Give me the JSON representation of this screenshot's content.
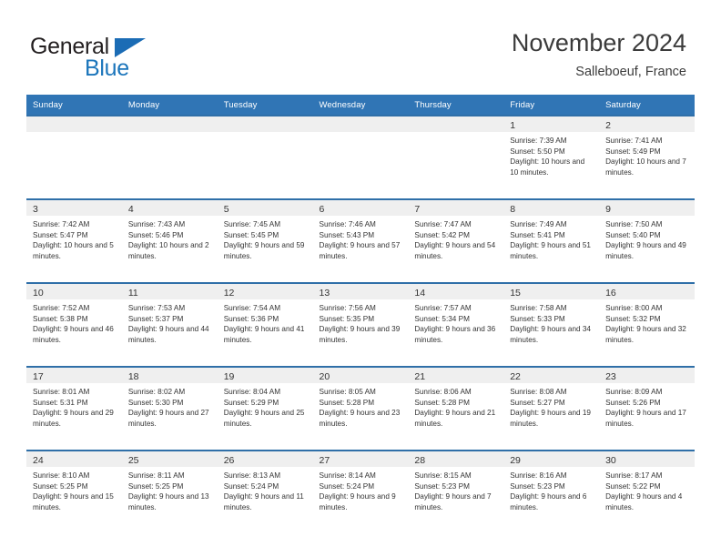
{
  "brand": {
    "word1": "General",
    "word2": "Blue",
    "triangle_color": "#1b6cb5",
    "word2_color": "#1b75bb"
  },
  "header": {
    "title": "November 2024",
    "subtitle": "Salleboeuf, France"
  },
  "colors": {
    "header_blue": "#3075b5",
    "row_border_blue": "#2f6fa8",
    "daynum_band": "#efefef",
    "text": "#333333"
  },
  "calendar": {
    "weekday_headers": [
      "Sunday",
      "Monday",
      "Tuesday",
      "Wednesday",
      "Thursday",
      "Friday",
      "Saturday"
    ],
    "weeks": [
      [
        {
          "day": "",
          "sunrise": "",
          "sunset": "",
          "daylight": ""
        },
        {
          "day": "",
          "sunrise": "",
          "sunset": "",
          "daylight": ""
        },
        {
          "day": "",
          "sunrise": "",
          "sunset": "",
          "daylight": ""
        },
        {
          "day": "",
          "sunrise": "",
          "sunset": "",
          "daylight": ""
        },
        {
          "day": "",
          "sunrise": "",
          "sunset": "",
          "daylight": ""
        },
        {
          "day": "1",
          "sunrise": "Sunrise: 7:39 AM",
          "sunset": "Sunset: 5:50 PM",
          "daylight": "Daylight: 10 hours and 10 minutes."
        },
        {
          "day": "2",
          "sunrise": "Sunrise: 7:41 AM",
          "sunset": "Sunset: 5:49 PM",
          "daylight": "Daylight: 10 hours and 7 minutes."
        }
      ],
      [
        {
          "day": "3",
          "sunrise": "Sunrise: 7:42 AM",
          "sunset": "Sunset: 5:47 PM",
          "daylight": "Daylight: 10 hours and 5 minutes."
        },
        {
          "day": "4",
          "sunrise": "Sunrise: 7:43 AM",
          "sunset": "Sunset: 5:46 PM",
          "daylight": "Daylight: 10 hours and 2 minutes."
        },
        {
          "day": "5",
          "sunrise": "Sunrise: 7:45 AM",
          "sunset": "Sunset: 5:45 PM",
          "daylight": "Daylight: 9 hours and 59 minutes."
        },
        {
          "day": "6",
          "sunrise": "Sunrise: 7:46 AM",
          "sunset": "Sunset: 5:43 PM",
          "daylight": "Daylight: 9 hours and 57 minutes."
        },
        {
          "day": "7",
          "sunrise": "Sunrise: 7:47 AM",
          "sunset": "Sunset: 5:42 PM",
          "daylight": "Daylight: 9 hours and 54 minutes."
        },
        {
          "day": "8",
          "sunrise": "Sunrise: 7:49 AM",
          "sunset": "Sunset: 5:41 PM",
          "daylight": "Daylight: 9 hours and 51 minutes."
        },
        {
          "day": "9",
          "sunrise": "Sunrise: 7:50 AM",
          "sunset": "Sunset: 5:40 PM",
          "daylight": "Daylight: 9 hours and 49 minutes."
        }
      ],
      [
        {
          "day": "10",
          "sunrise": "Sunrise: 7:52 AM",
          "sunset": "Sunset: 5:38 PM",
          "daylight": "Daylight: 9 hours and 46 minutes."
        },
        {
          "day": "11",
          "sunrise": "Sunrise: 7:53 AM",
          "sunset": "Sunset: 5:37 PM",
          "daylight": "Daylight: 9 hours and 44 minutes."
        },
        {
          "day": "12",
          "sunrise": "Sunrise: 7:54 AM",
          "sunset": "Sunset: 5:36 PM",
          "daylight": "Daylight: 9 hours and 41 minutes."
        },
        {
          "day": "13",
          "sunrise": "Sunrise: 7:56 AM",
          "sunset": "Sunset: 5:35 PM",
          "daylight": "Daylight: 9 hours and 39 minutes."
        },
        {
          "day": "14",
          "sunrise": "Sunrise: 7:57 AM",
          "sunset": "Sunset: 5:34 PM",
          "daylight": "Daylight: 9 hours and 36 minutes."
        },
        {
          "day": "15",
          "sunrise": "Sunrise: 7:58 AM",
          "sunset": "Sunset: 5:33 PM",
          "daylight": "Daylight: 9 hours and 34 minutes."
        },
        {
          "day": "16",
          "sunrise": "Sunrise: 8:00 AM",
          "sunset": "Sunset: 5:32 PM",
          "daylight": "Daylight: 9 hours and 32 minutes."
        }
      ],
      [
        {
          "day": "17",
          "sunrise": "Sunrise: 8:01 AM",
          "sunset": "Sunset: 5:31 PM",
          "daylight": "Daylight: 9 hours and 29 minutes."
        },
        {
          "day": "18",
          "sunrise": "Sunrise: 8:02 AM",
          "sunset": "Sunset: 5:30 PM",
          "daylight": "Daylight: 9 hours and 27 minutes."
        },
        {
          "day": "19",
          "sunrise": "Sunrise: 8:04 AM",
          "sunset": "Sunset: 5:29 PM",
          "daylight": "Daylight: 9 hours and 25 minutes."
        },
        {
          "day": "20",
          "sunrise": "Sunrise: 8:05 AM",
          "sunset": "Sunset: 5:28 PM",
          "daylight": "Daylight: 9 hours and 23 minutes."
        },
        {
          "day": "21",
          "sunrise": "Sunrise: 8:06 AM",
          "sunset": "Sunset: 5:28 PM",
          "daylight": "Daylight: 9 hours and 21 minutes."
        },
        {
          "day": "22",
          "sunrise": "Sunrise: 8:08 AM",
          "sunset": "Sunset: 5:27 PM",
          "daylight": "Daylight: 9 hours and 19 minutes."
        },
        {
          "day": "23",
          "sunrise": "Sunrise: 8:09 AM",
          "sunset": "Sunset: 5:26 PM",
          "daylight": "Daylight: 9 hours and 17 minutes."
        }
      ],
      [
        {
          "day": "24",
          "sunrise": "Sunrise: 8:10 AM",
          "sunset": "Sunset: 5:25 PM",
          "daylight": "Daylight: 9 hours and 15 minutes."
        },
        {
          "day": "25",
          "sunrise": "Sunrise: 8:11 AM",
          "sunset": "Sunset: 5:25 PM",
          "daylight": "Daylight: 9 hours and 13 minutes."
        },
        {
          "day": "26",
          "sunrise": "Sunrise: 8:13 AM",
          "sunset": "Sunset: 5:24 PM",
          "daylight": "Daylight: 9 hours and 11 minutes."
        },
        {
          "day": "27",
          "sunrise": "Sunrise: 8:14 AM",
          "sunset": "Sunset: 5:24 PM",
          "daylight": "Daylight: 9 hours and 9 minutes."
        },
        {
          "day": "28",
          "sunrise": "Sunrise: 8:15 AM",
          "sunset": "Sunset: 5:23 PM",
          "daylight": "Daylight: 9 hours and 7 minutes."
        },
        {
          "day": "29",
          "sunrise": "Sunrise: 8:16 AM",
          "sunset": "Sunset: 5:23 PM",
          "daylight": "Daylight: 9 hours and 6 minutes."
        },
        {
          "day": "30",
          "sunrise": "Sunrise: 8:17 AM",
          "sunset": "Sunset: 5:22 PM",
          "daylight": "Daylight: 9 hours and 4 minutes."
        }
      ]
    ]
  }
}
